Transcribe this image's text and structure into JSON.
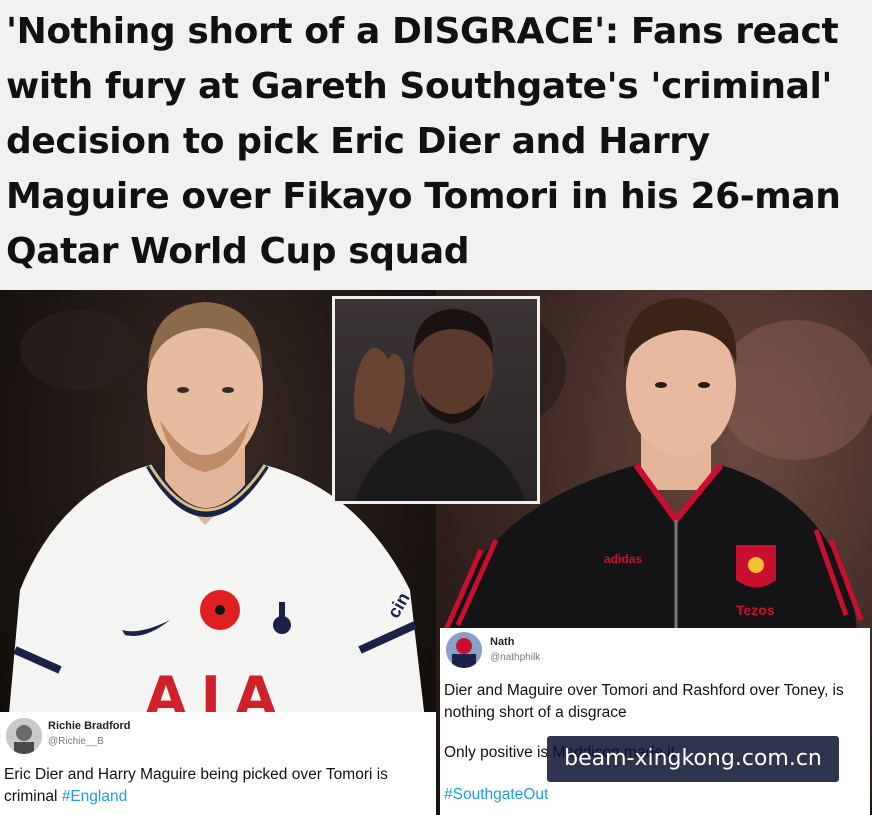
{
  "headline": "'Nothing short of a DISGRACE': Fans react with fury at Gareth Southgate's 'criminal' decision to pick Eric Dier and Harry Maguire over Fikayo Tomori in his 26-man Qatar World Cup squad",
  "photos": {
    "left": {
      "shirt_sponsor": "AIA",
      "sleeve_text": "cin"
    },
    "right": {
      "brand": "adidas",
      "sponsor": "Tezos"
    }
  },
  "tweets": [
    {
      "name": "Richie Bradford",
      "handle": "@Richie__B",
      "text": "Eric Dier and Harry Maguire being picked over Tomori is criminal",
      "hashtag": "#England"
    },
    {
      "name": "Nath",
      "handle": "@nathphilk",
      "text": "Dier and Maguire over Tomori and Rashford over Toney, is nothing short of a disgrace",
      "text2": "Only positive is Maddison made it",
      "hashtag": "#SouthgateOut"
    }
  ],
  "watermark": "beam-xingkong.com.cn",
  "colors": {
    "headline_bg": "#f1f1f1",
    "hashtag": "#1d9bf0",
    "spurs_kit": "#f4f4f2",
    "united_jacket": "#141416",
    "united_trim": "#c8102e",
    "watermark_bg": "#0a1230"
  }
}
